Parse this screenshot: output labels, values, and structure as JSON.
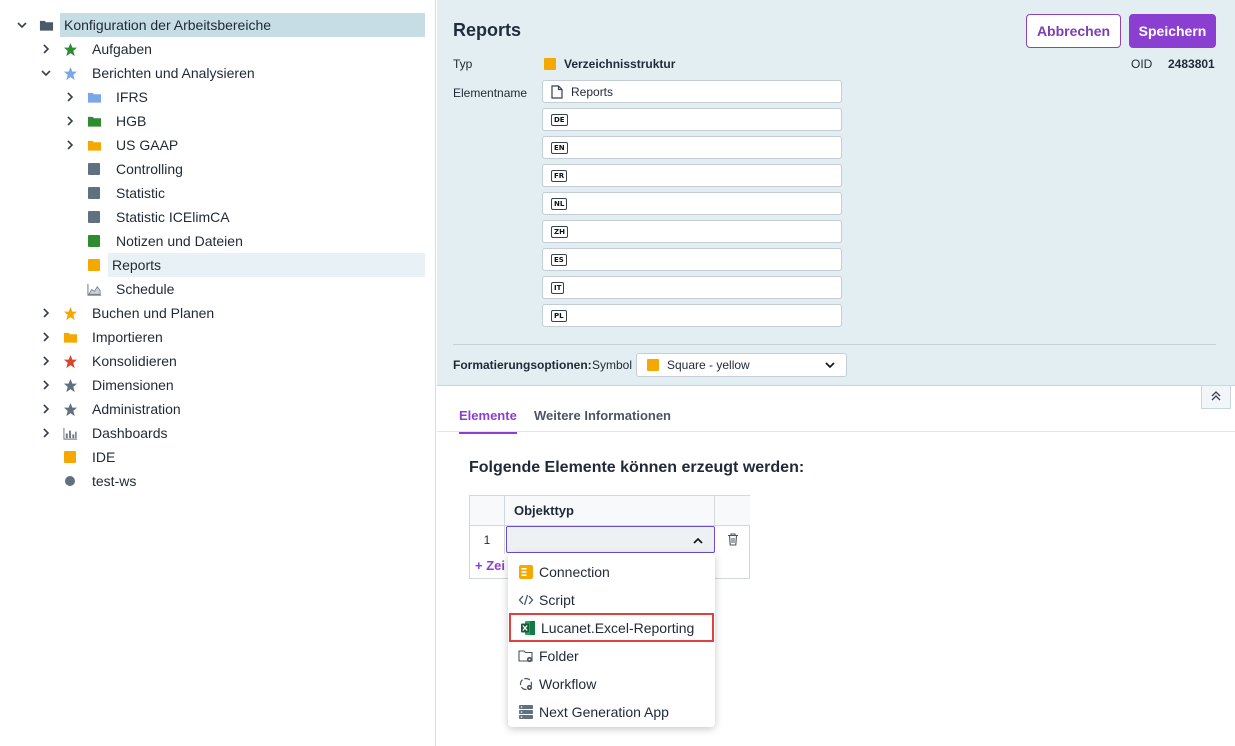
{
  "tree": {
    "root": "Konfiguration der Arbeitsbereiche",
    "items": [
      {
        "label": "Aufgaben"
      },
      {
        "label": "Berichten und Analysieren"
      },
      {
        "label": "IFRS"
      },
      {
        "label": "HGB"
      },
      {
        "label": "US GAAP"
      },
      {
        "label": "Controlling"
      },
      {
        "label": "Statistic"
      },
      {
        "label": "Statistic ICElimCA"
      },
      {
        "label": "Notizen und Dateien"
      },
      {
        "label": "Reports"
      },
      {
        "label": "Schedule"
      },
      {
        "label": "Buchen und Planen"
      },
      {
        "label": "Importieren"
      },
      {
        "label": "Konsolidieren"
      },
      {
        "label": "Dimensionen"
      },
      {
        "label": "Administration"
      },
      {
        "label": "Dashboards"
      },
      {
        "label": "IDE"
      },
      {
        "label": "test-ws"
      }
    ]
  },
  "detail": {
    "title": "Reports",
    "cancel": "Abbrechen",
    "save": "Speichern",
    "type_label": "Typ",
    "type_value": "Verzeichnisstruktur",
    "oid_label": "OID",
    "oid_value": "2483801",
    "name_label": "Elementname",
    "name_value": "Reports",
    "languages": [
      "DE",
      "EN",
      "FR",
      "NL",
      "ZH",
      "ES",
      "IT",
      "PL"
    ],
    "format_label": "Formatierungsoptionen:",
    "symbol_label": "Symbol",
    "symbol_value": "Square - yellow"
  },
  "tabs": [
    {
      "label": "Elemente"
    },
    {
      "label": "Weitere Informationen"
    }
  ],
  "section": {
    "title": "Folgende Elemente können erzeugt werden:",
    "column": "Objekttyp",
    "row_number": "1",
    "add_row": "+ Zei"
  },
  "dropdown": {
    "options": [
      {
        "label": "Connection"
      },
      {
        "label": "Script"
      },
      {
        "label": "Lucanet.Excel-Reporting"
      },
      {
        "label": "Folder"
      },
      {
        "label": "Workflow"
      },
      {
        "label": "Next Generation App"
      }
    ]
  },
  "colors": {
    "accent": "#8b3fd1",
    "yellow": "#f5a800",
    "green": "#2e8b2e",
    "slate": "#5f7080",
    "blue": "#7ba7e8",
    "red": "#d9462b",
    "highlight": "#e04040"
  }
}
